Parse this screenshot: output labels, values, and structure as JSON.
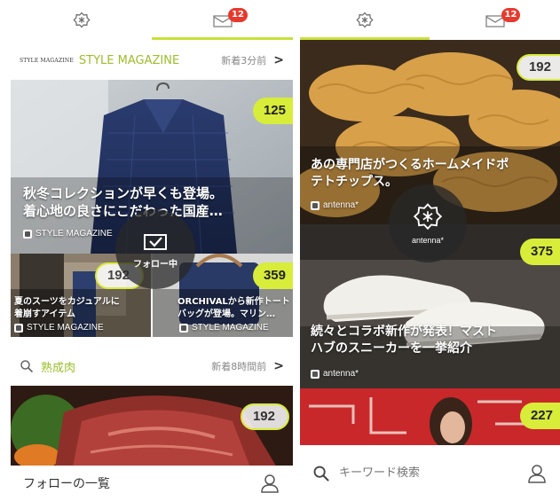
{
  "left": {
    "badge": "12",
    "magazine": {
      "small_logo": "STYLE MAGAZINE",
      "title": "STYLE MAGAZINE",
      "time": "新着3分前",
      "chevron": ">"
    },
    "hero": {
      "count": "125",
      "title_line1": "秋冬コレクションが早くも登場。",
      "title_line2": "着心地の良さにこだわった国産…",
      "source": "STYLE MAGAZINE"
    },
    "follow_overlay": {
      "label": "フォロー中"
    },
    "sub_left": {
      "count": "192",
      "title_line1": "夏のスーツをカジュアルに",
      "title_line2": "着崩すアイテム",
      "source": "STYLE MAGAZINE"
    },
    "sub_right": {
      "count": "359",
      "title_line1": "ORCHIVALから新作トート",
      "title_line2": "バッグが登場。マリン…",
      "source": "STYLE MAGAZINE"
    },
    "keyword": {
      "title": "熟成肉",
      "time": "新着8時間前",
      "chevron": ">"
    },
    "meat": {
      "count": "192"
    },
    "footer": {
      "label": "フォローの一覧"
    }
  },
  "right": {
    "badge": "12",
    "chips": {
      "count": "192",
      "title_line1": "あの専門店がつくるホームメイドポ",
      "title_line2": "テトチップス。",
      "source": "antenna*"
    },
    "logo_overlay": {
      "label": "antenna*"
    },
    "shoes": {
      "count": "375",
      "title_line1": "続々とコラボ新作が発表！マスト",
      "title_line2": "ハブのスニーカーを一挙紹介",
      "source": "antenna*"
    },
    "street": {
      "count": "227"
    },
    "search": {
      "placeholder": "キーワード検索"
    }
  },
  "colors": {
    "accent": "#c9e03a",
    "count_badge": "#d8ec3a",
    "keyword_green": "#9bbe2a",
    "notification_red": "#e63a2e"
  },
  "icons": [
    "antenna-logo-icon",
    "mail-icon",
    "chevron-right-icon",
    "search-icon",
    "person-icon",
    "checkmark-icon"
  ]
}
